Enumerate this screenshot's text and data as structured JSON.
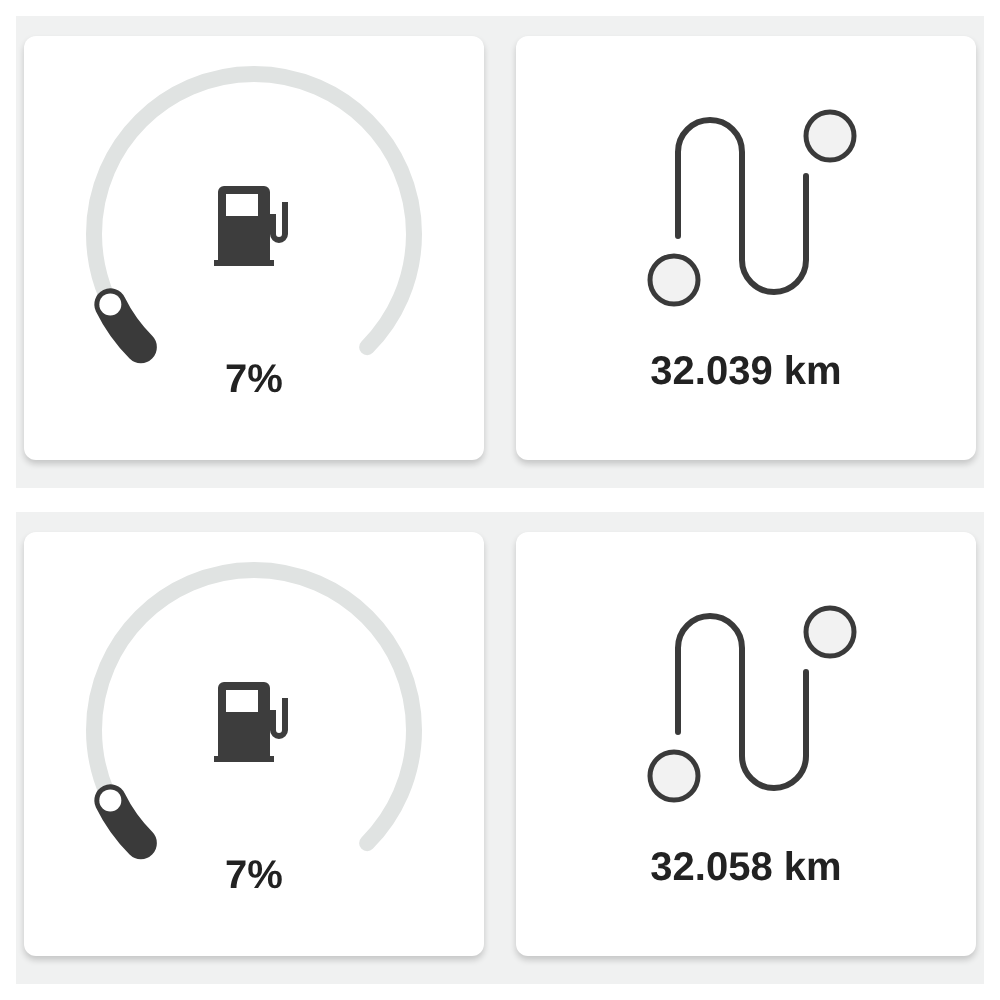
{
  "panels": [
    {
      "fuel": {
        "reading": "7%"
      },
      "distance": "32.039 km"
    },
    {
      "fuel": {
        "reading": "7%"
      },
      "distance": "32.058 km"
    }
  ]
}
